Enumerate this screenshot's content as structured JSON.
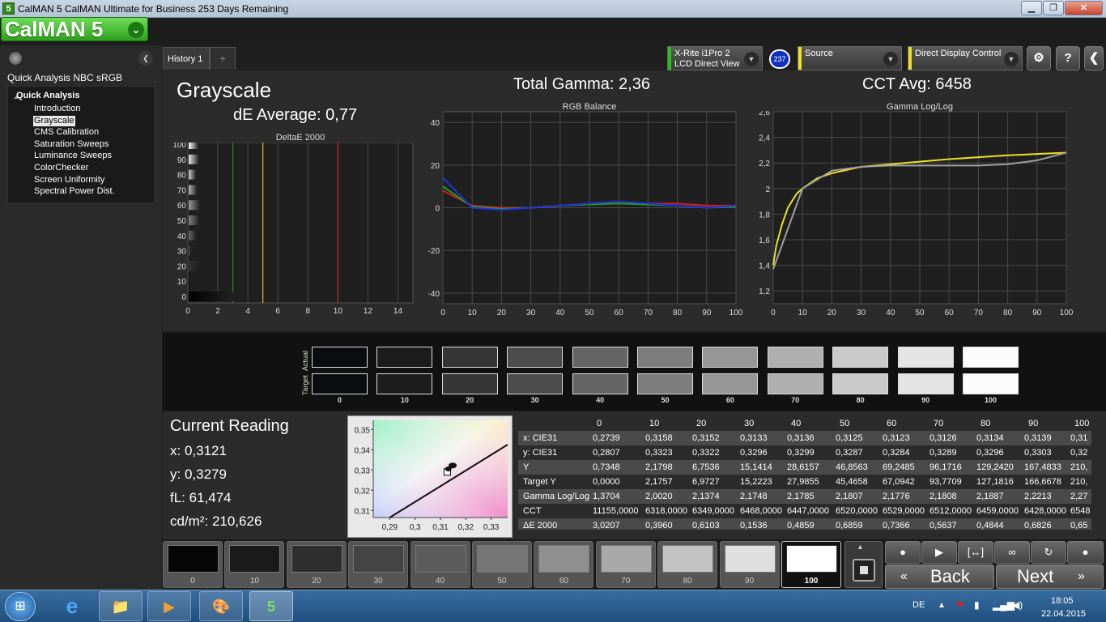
{
  "window": {
    "title": "CalMAN 5 CalMAN Ultimate for Business 253 Days Remaining",
    "minimize": "▁",
    "restore": "❐",
    "close": "✕"
  },
  "app": {
    "logo": "CalMAN 5",
    "logo_dd": "⌄"
  },
  "devices": {
    "meter_line1": "X-Rite i1Pro 2",
    "meter_line2": "LCD Direct View",
    "meter_badge": "237",
    "source": "Source",
    "display": "Direct Display Control",
    "meter_color": "#27c018",
    "source_color": "#f0e020",
    "display_color": "#f0e020"
  },
  "toolbar": {
    "settings_icon": "⚙",
    "help_label": "?",
    "collapse": "❮"
  },
  "sidebar": {
    "collapse": "❮",
    "title": "Quick Analysis NBC sRGB",
    "group": "Quick Analysis",
    "items": [
      "Introduction",
      "Grayscale",
      "CMS Calibration",
      "Saturation Sweeps",
      "Luminance Sweeps",
      "ColorChecker",
      "Screen Uniformity",
      "Spectral Power Dist."
    ],
    "selected_index": 1
  },
  "tabs": {
    "history": "History 1",
    "add": "+"
  },
  "page": {
    "title": "Grayscale",
    "de_average": "dE Average: 0,77",
    "total_gamma": "Total Gamma: 2,36",
    "cct_avg": "CCT Avg: 6458"
  },
  "chart_data": [
    {
      "type": "bar",
      "title": "DeltaE 2000",
      "orientation": "horizontal",
      "categories": [
        "0",
        "10",
        "20",
        "30",
        "40",
        "50",
        "60",
        "70",
        "80",
        "90",
        "100"
      ],
      "values": [
        3.02,
        0.4,
        0.61,
        0.15,
        0.49,
        0.69,
        0.74,
        0.56,
        0.48,
        0.68,
        0.65
      ],
      "xlim": [
        0,
        15
      ],
      "xticks": [
        "0",
        "2",
        "4",
        "6",
        "8",
        "10",
        "12",
        "14"
      ],
      "yticks": [
        "0",
        "10",
        "20",
        "30",
        "40",
        "50",
        "60",
        "70",
        "80",
        "90",
        "100"
      ],
      "thresholds": [
        {
          "x": 3,
          "color": "#2a8a2a"
        },
        {
          "x": 5,
          "color": "#c8c820"
        },
        {
          "x": 10,
          "color": "#d02020"
        }
      ]
    },
    {
      "type": "line",
      "title": "RGB Balance",
      "x": [
        0,
        10,
        20,
        30,
        40,
        50,
        60,
        70,
        80,
        90,
        100
      ],
      "ylim": [
        -45,
        45
      ],
      "yticks": [
        "40",
        "20",
        "0",
        "-20",
        "-40"
      ],
      "xticks": [
        "0",
        "10",
        "20",
        "30",
        "40",
        "50",
        "60",
        "70",
        "80",
        "90",
        "100"
      ],
      "series": [
        {
          "color": "#d02020",
          "values": [
            8,
            1,
            0,
            0,
            1,
            2,
            2,
            2,
            2,
            1,
            1
          ]
        },
        {
          "color": "#20a020",
          "values": [
            10,
            0.5,
            -0.5,
            0,
            1,
            1.5,
            2,
            1.5,
            1,
            0,
            0.5
          ]
        },
        {
          "color": "#2030e0",
          "values": [
            14,
            0,
            -1,
            0,
            1,
            2,
            3,
            2,
            1,
            0,
            1
          ]
        }
      ]
    },
    {
      "type": "line",
      "title": "Gamma Log/Log",
      "x": [
        0,
        10,
        20,
        30,
        40,
        50,
        60,
        70,
        80,
        90,
        100
      ],
      "ylim": [
        1.1,
        2.6
      ],
      "yticks": [
        "2,6",
        "2,4",
        "2,2",
        "2",
        "1,8",
        "1,6",
        "1,4",
        "1,2"
      ],
      "xticks": [
        "0",
        "10",
        "20",
        "30",
        "40",
        "50",
        "60",
        "70",
        "80",
        "90",
        "100"
      ],
      "series": [
        {
          "color": "#f0e020",
          "x": [
            0,
            1,
            3,
            5,
            8,
            10,
            15,
            20,
            30,
            40,
            50,
            60,
            70,
            80,
            90,
            100
          ],
          "values": [
            1.4,
            1.55,
            1.72,
            1.85,
            1.96,
            2.0,
            2.08,
            2.12,
            2.17,
            2.19,
            2.21,
            2.23,
            2.245,
            2.26,
            2.27,
            2.28
          ]
        },
        {
          "color": "#a0a0a0",
          "x": [
            0,
            10,
            20,
            30,
            40,
            50,
            60,
            70,
            80,
            90,
            100
          ],
          "values": [
            1.37,
            2.0,
            2.14,
            2.17,
            2.18,
            2.18,
            2.18,
            2.18,
            2.19,
            2.22,
            2.28
          ]
        }
      ]
    }
  ],
  "swatches": {
    "actual_label": "Actual",
    "target_label": "Target",
    "labels": [
      "0",
      "10",
      "20",
      "30",
      "40",
      "50",
      "60",
      "70",
      "80",
      "90",
      "100"
    ],
    "colors": [
      "#0b0c10",
      "#1c1c1c",
      "#353535",
      "#4c4c4c",
      "#646464",
      "#7d7d7d",
      "#969696",
      "#afafaf",
      "#cacaca",
      "#e4e4e4",
      "#fcfcfc"
    ]
  },
  "reading": {
    "title": "Current Reading",
    "x": "x: 0,3121",
    "y": "y: 0,3279",
    "fl": "fL: 61,474",
    "cdm2": "cd/m²: 210,626"
  },
  "cie_chart": {
    "xticks": [
      "0,29",
      "0,3",
      "0,31",
      "0,32",
      "0,33"
    ],
    "yticks": [
      "0,35",
      "0,34",
      "0,33",
      "0,32",
      "0,31"
    ]
  },
  "table": {
    "columns": [
      "0",
      "10",
      "20",
      "30",
      "40",
      "50",
      "60",
      "70",
      "80",
      "90",
      "100"
    ],
    "rows": [
      {
        "label": "x: CIE31",
        "values": [
          "0,2739",
          "0,3158",
          "0,3152",
          "0,3133",
          "0,3136",
          "0,3125",
          "0,3123",
          "0,3126",
          "0,3134",
          "0,3139",
          "0,31"
        ]
      },
      {
        "label": "y: CIE31",
        "values": [
          "0,2807",
          "0,3323",
          "0,3322",
          "0,3296",
          "0,3299",
          "0,3287",
          "0,3284",
          "0,3289",
          "0,3296",
          "0,3303",
          "0,32"
        ]
      },
      {
        "label": "Y",
        "values": [
          "0,7348",
          "2,1798",
          "6,7536",
          "15,1414",
          "28,6157",
          "46,8563",
          "69,2485",
          "96,1716",
          "129,2420",
          "167,4833",
          "210,"
        ]
      },
      {
        "label": "Target Y",
        "values": [
          "0,0000",
          "2,1757",
          "6,9727",
          "15,2223",
          "27,9855",
          "45,4658",
          "67,0942",
          "93,7709",
          "127,1816",
          "166,6678",
          "210,"
        ]
      },
      {
        "label": "Gamma Log/Log",
        "values": [
          "1,3704",
          "2,0020",
          "2,1374",
          "2,1748",
          "2,1785",
          "2,1807",
          "2,1776",
          "2,1808",
          "2,1887",
          "2,2213",
          "2,27"
        ]
      },
      {
        "label": "CCT",
        "values": [
          "11155,0000",
          "6318,0000",
          "6349,0000",
          "6468,0000",
          "6447,0000",
          "6520,0000",
          "6529,0000",
          "6512,0000",
          "6459,0000",
          "6428,0000",
          "6548"
        ]
      },
      {
        "label": "ΔE 2000",
        "values": [
          "3,0207",
          "0,3960",
          "0,6103",
          "0,1536",
          "0,4859",
          "0,6859",
          "0,7366",
          "0,5637",
          "0,4844",
          "0,6826",
          "0,65"
        ]
      }
    ]
  },
  "bottom": {
    "swatch_labels": [
      "0",
      "10",
      "20",
      "30",
      "40",
      "50",
      "60",
      "70",
      "80",
      "90",
      "100"
    ],
    "swatch_colors": [
      "#050505",
      "#1a1a1a",
      "#2e2e2e",
      "#444",
      "#5c5c5c",
      "#767676",
      "#8f8f8f",
      "#a9a9a9",
      "#c3c3c3",
      "#dfdfdf",
      "#ffffff"
    ],
    "back": "Back",
    "next": "Next"
  },
  "taskbar": {
    "lang": "DE",
    "time": "18:05",
    "date": "22.04.2015"
  }
}
